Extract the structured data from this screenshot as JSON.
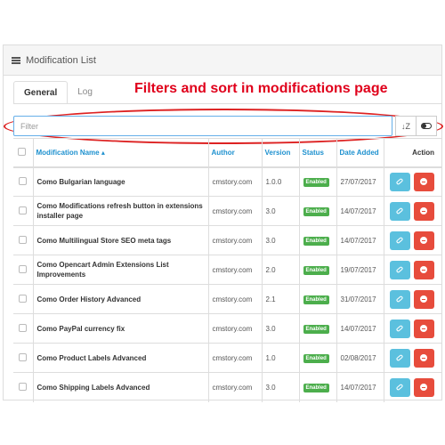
{
  "panel": {
    "title": "Modification List"
  },
  "tabs": [
    {
      "label": "General"
    },
    {
      "label": "Log"
    }
  ],
  "headline": "Filters and sort in modifications page",
  "filter": {
    "placeholder": "Filter",
    "sort_glyph": "↓Z",
    "toggle_icon": "toggle-icon"
  },
  "table": {
    "headers": {
      "name": "Modification Name ▴",
      "author": "Author",
      "version": "Version",
      "status": "Status",
      "date": "Date Added",
      "action": "Action"
    },
    "rows": [
      {
        "name": "Como Bulgarian language",
        "author": "cmstory.com",
        "version": "1.0.0",
        "status": "Enabled",
        "date": "27/07/2017"
      },
      {
        "name": "Como Modifications refresh button in extensions installer page",
        "author": "cmstory.com",
        "version": "3.0",
        "status": "Enabled",
        "date": "14/07/2017"
      },
      {
        "name": "Como Multilingual Store SEO meta tags",
        "author": "cmstory.com",
        "version": "3.0",
        "status": "Enabled",
        "date": "14/07/2017"
      },
      {
        "name": "Como Opencart Admin Extensions List Improvements",
        "author": "cmstory.com",
        "version": "2.0",
        "status": "Enabled",
        "date": "19/07/2017"
      },
      {
        "name": "Como Order History Advanced",
        "author": "cmstory.com",
        "version": "2.1",
        "status": "Enabled",
        "date": "31/07/2017"
      },
      {
        "name": "Como PayPal currency fix",
        "author": "cmstory.com",
        "version": "3.0",
        "status": "Enabled",
        "date": "14/07/2017"
      },
      {
        "name": "Como Product Labels Advanced",
        "author": "cmstory.com",
        "version": "1.0",
        "status": "Enabled",
        "date": "02/08/2017"
      },
      {
        "name": "Como Shipping Labels Advanced",
        "author": "cmstory.com",
        "version": "3.0",
        "status": "Enabled",
        "date": "14/07/2017"
      }
    ]
  },
  "colors": {
    "accent": "#1e91cf",
    "headline": "#e0001b",
    "enabled": "#4cae4c",
    "edit_button": "#5bc0de",
    "disable_button": "#e74c3c"
  }
}
